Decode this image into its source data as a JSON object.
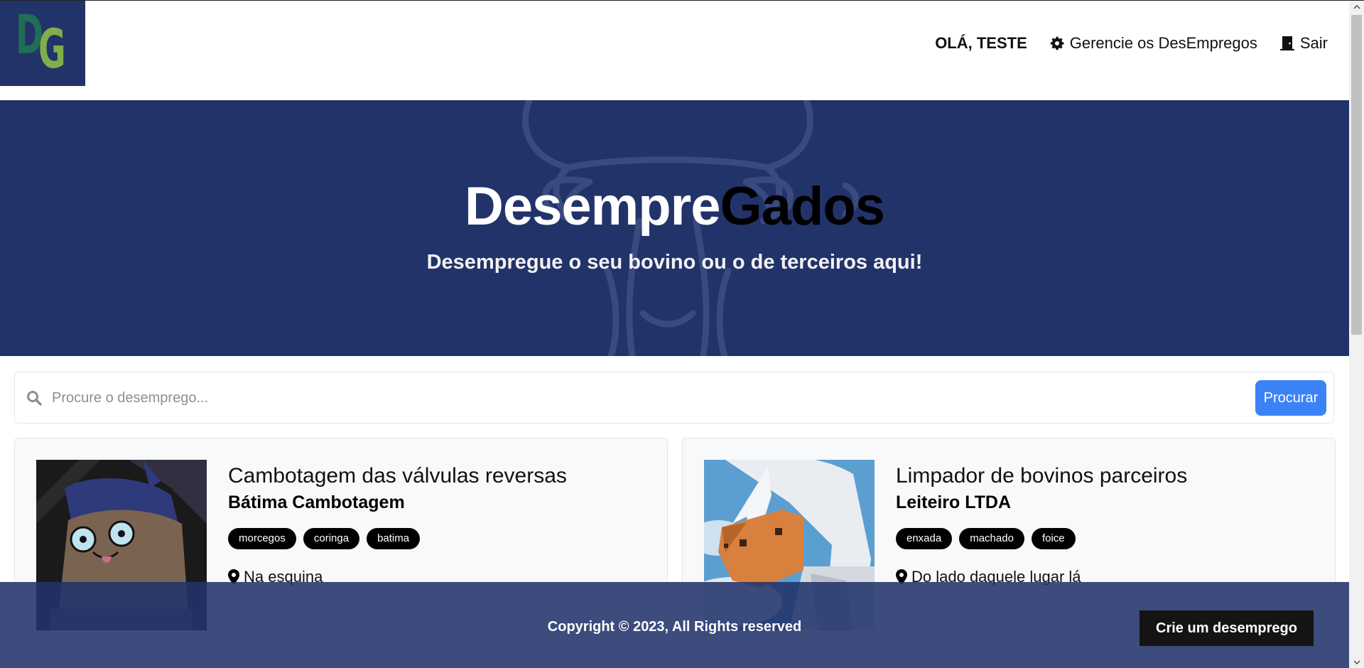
{
  "header": {
    "logo_alt": "DG",
    "logo_letters": [
      "D",
      "G"
    ],
    "greeting": "OLÁ, TESTE",
    "manage_label": "Gerencie os DesEmpregos",
    "logout_label": "Sair"
  },
  "hero": {
    "title_part1": "Desempre",
    "title_part2": "Gados",
    "subtitle": "Desempregue o seu bovino ou o de terceiros aqui!"
  },
  "search": {
    "placeholder": "Procure o desemprego...",
    "value": "",
    "button_label": "Procurar"
  },
  "jobs": [
    {
      "title": "Cambotagem das válvulas reversas",
      "company": "Bátima Cambotagem",
      "tags": [
        "morcegos",
        "coringa",
        "batima"
      ],
      "location": "Na esquina"
    },
    {
      "title": "Limpador de bovinos parceiros",
      "company": "Leiteiro LTDA",
      "tags": [
        "enxada",
        "machado",
        "foice"
      ],
      "location": "Do lado daquele lugar lá"
    }
  ],
  "footer": {
    "copyright": "Copyright © 2023, All Rights reserved",
    "create_button": "Crie um desemprego"
  },
  "colors": {
    "brand_navy": "#22336a",
    "logo_green_dark": "#1f6e55",
    "logo_green_light": "#7fae4a",
    "search_button": "#3b82f6",
    "tag_background": "#000000"
  },
  "icons": {
    "manage": "gear-icon",
    "logout": "door-icon",
    "search": "search-icon",
    "location": "map-pin-icon"
  }
}
